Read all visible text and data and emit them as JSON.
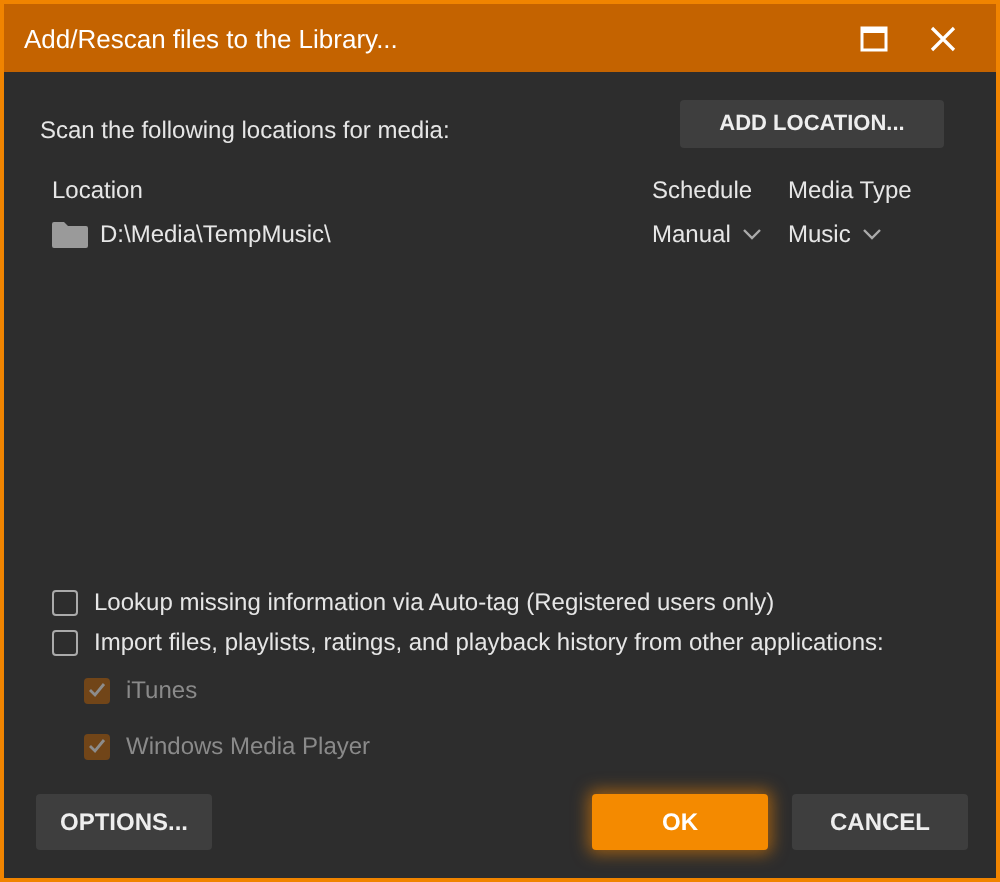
{
  "window": {
    "title": "Add/Rescan files to the Library..."
  },
  "scan_label": "Scan the following locations for media:",
  "add_location_button": "ADD LOCATION...",
  "table": {
    "columns": [
      "Location",
      "Schedule",
      "Media Type"
    ],
    "rows": [
      {
        "location": "D:\\Media\\TempMusic\\",
        "schedule": "Manual",
        "media_type": "Music"
      }
    ]
  },
  "options": [
    {
      "label": "Lookup missing information via Auto-tag (Registered users only)",
      "checked": false,
      "disabled": false
    },
    {
      "label": "Import files, playlists, ratings, and playback history from other applications:",
      "checked": false,
      "disabled": false,
      "children": [
        {
          "label": "iTunes",
          "checked": true,
          "disabled": true
        },
        {
          "label": "Windows Media Player",
          "checked": true,
          "disabled": true
        }
      ]
    }
  ],
  "buttons": [
    {
      "label": "OPTIONS...",
      "kind": "secondary"
    },
    {
      "label": "OK",
      "kind": "primary"
    },
    {
      "label": "CANCEL",
      "kind": "secondary"
    }
  ]
}
